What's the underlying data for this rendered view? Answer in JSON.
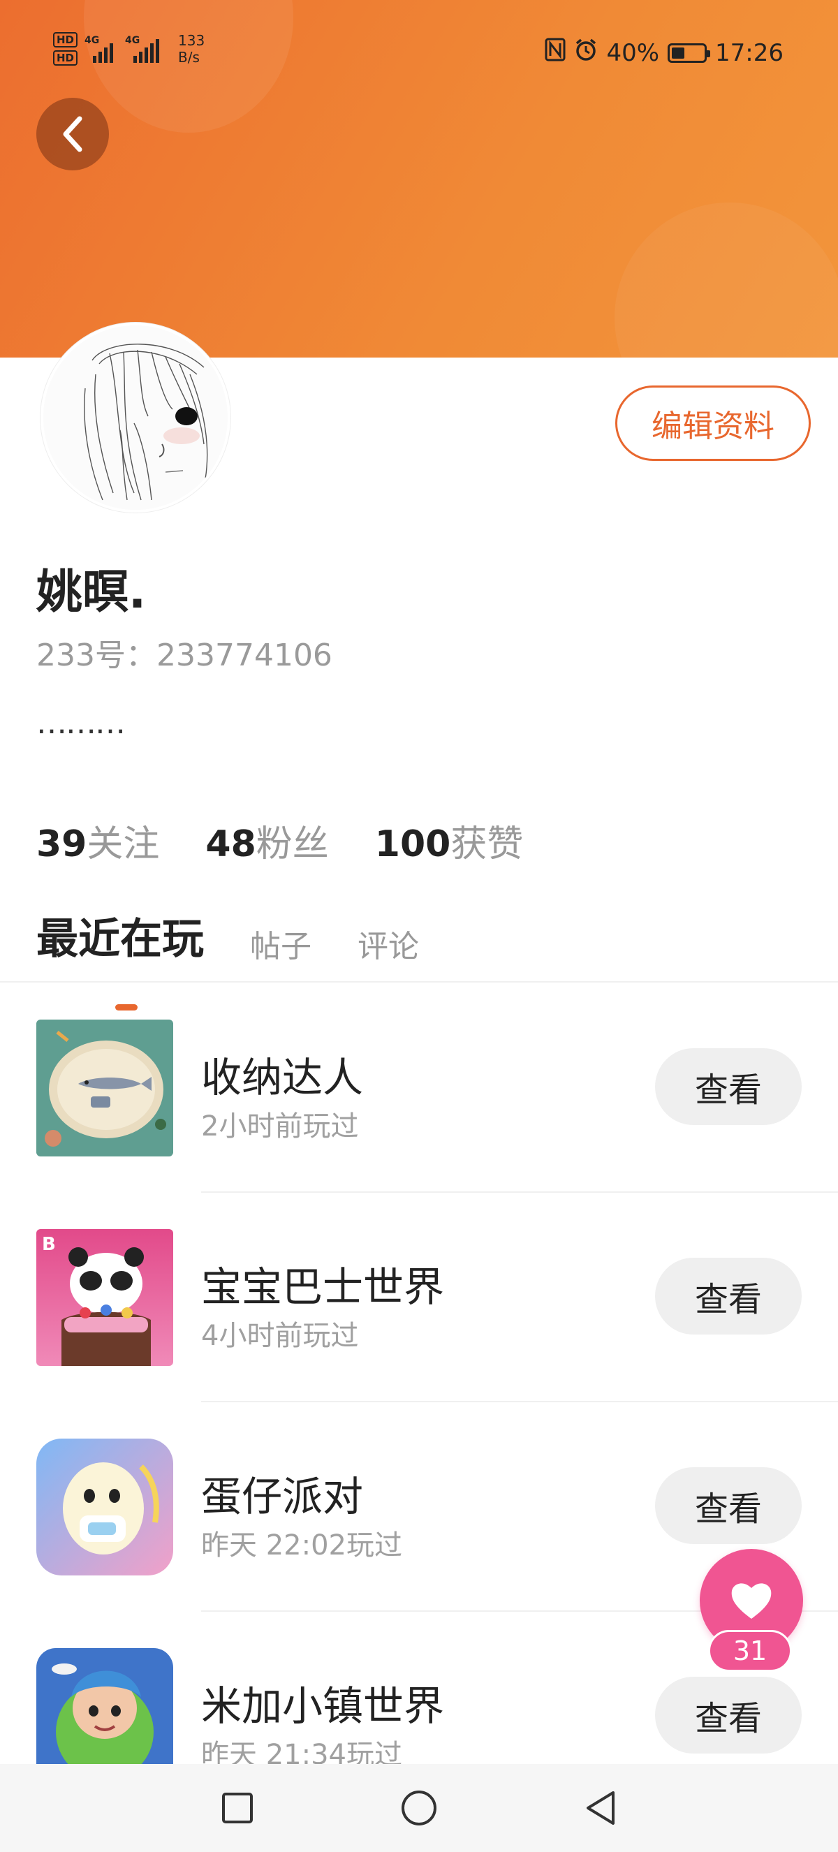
{
  "status_bar": {
    "hd1": "HD",
    "hd2": "HD",
    "net1": "4G",
    "net2": "4G",
    "speed_value": "133",
    "speed_unit": "B/s",
    "battery_pct": "40%",
    "battery_level": 0.4,
    "time": "17:26",
    "icons": [
      "nfc-icon",
      "alarm-icon",
      "battery-icon"
    ]
  },
  "profile": {
    "nickname": "姚暝.",
    "id_label": "233号：233774106",
    "bio": "………",
    "edit_label": "编辑资料"
  },
  "stats": [
    {
      "value": "39",
      "label": "关注"
    },
    {
      "value": "48",
      "label": "粉丝"
    },
    {
      "value": "100",
      "label": "获赞"
    }
  ],
  "tabs": [
    {
      "label": "最近在玩",
      "active": true
    },
    {
      "label": "帖子",
      "active": false
    },
    {
      "label": "评论",
      "active": false
    }
  ],
  "games": [
    {
      "title": "收纳达人",
      "played": "2小时前玩过",
      "button": "查看"
    },
    {
      "title": "宝宝巴士世界",
      "played": "4小时前玩过",
      "button": "查看"
    },
    {
      "title": "蛋仔派对",
      "played": "昨天 22:02玩过",
      "button": "查看"
    },
    {
      "title": "米加小镇世界",
      "played": "昨天 21:34玩过",
      "button": "查看"
    }
  ],
  "float_like": {
    "count": "31"
  },
  "colors": {
    "accent": "#e8672e",
    "like": "#f05592",
    "header_start": "#ec6e2f",
    "header_end": "#f3953b"
  }
}
